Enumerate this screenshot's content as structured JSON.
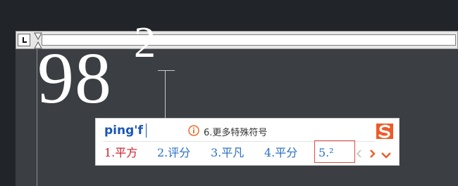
{
  "editor": {
    "base_text": "98",
    "superscript_text": "2"
  },
  "ruler": {
    "tab_selector_icon": "left-tab-icon",
    "indent_icon": "hourglass-indent-icon"
  },
  "ime": {
    "composition": "ping'f",
    "hint_icon": "info-circle-icon",
    "hint_text": "6.更多特殊符号",
    "candidates": [
      {
        "label": "1.平方"
      },
      {
        "label": "2.评分"
      },
      {
        "label": "3.平凡"
      },
      {
        "label": "4.平分"
      },
      {
        "label": "5.²"
      }
    ],
    "highlight_color": "#d0202a",
    "normal_color": "#2a6fc4",
    "nav_prev_icon": "chevron-left-icon",
    "nav_next_icon": "chevron-right-icon",
    "expand_icon": "chevron-down-icon",
    "logo_icon": "sogou-logo-icon",
    "accent_color": "#ef5a28"
  }
}
